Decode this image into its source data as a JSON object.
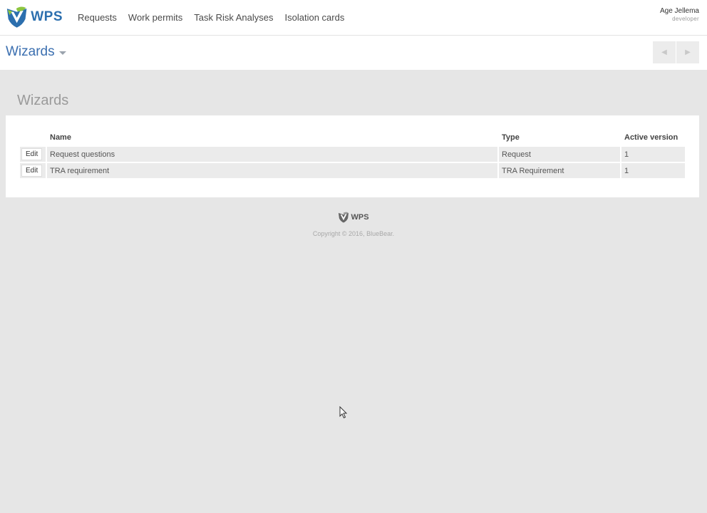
{
  "header": {
    "logo_text": "WPS",
    "nav": [
      "Requests",
      "Work permits",
      "Task Risk Analyses",
      "Isolation cards"
    ],
    "user_name": "Age Jellema",
    "user_role": "developer"
  },
  "subheader": {
    "title": "Wizards"
  },
  "page": {
    "heading": "Wizards"
  },
  "table": {
    "columns": [
      "Name",
      "Type",
      "Active version"
    ],
    "edit_label": "Edit",
    "rows": [
      {
        "name": "Request questions",
        "type": "Request",
        "version": "1"
      },
      {
        "name": "TRA requirement",
        "type": "TRA Requirement",
        "version": "1"
      }
    ]
  },
  "footer": {
    "logo_text": "WPS",
    "copyright": "Copyright © 2016, BlueBear."
  },
  "colors": {
    "brand_blue": "#2c6fae",
    "brand_green": "#8dc63f",
    "page_bg": "#e6e6e6"
  }
}
